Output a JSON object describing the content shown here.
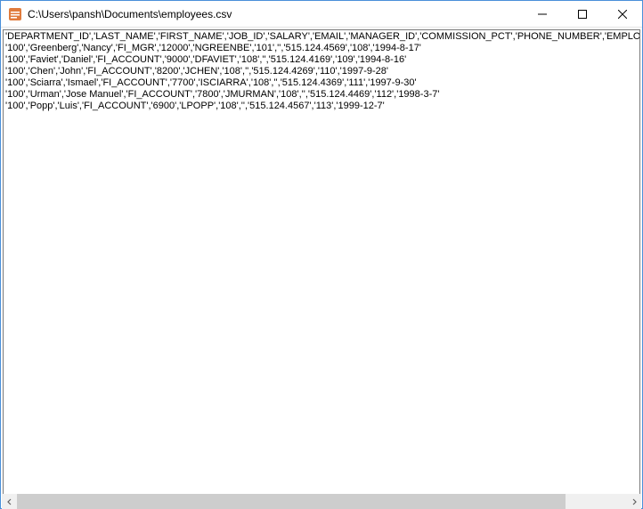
{
  "window": {
    "title": "C:\\Users\\pansh\\Documents\\employees.csv"
  },
  "content": {
    "lines": [
      "'DEPARTMENT_ID','LAST_NAME','FIRST_NAME','JOB_ID','SALARY','EMAIL','MANAGER_ID','COMMISSION_PCT','PHONE_NUMBER','EMPLOYEE_ID','H",
      "'100','Greenberg','Nancy','FI_MGR','12000','NGREENBE','101','','515.124.4569','108','1994-8-17'",
      "'100','Faviet','Daniel','FI_ACCOUNT','9000','DFAVIET','108','','515.124.4169','109','1994-8-16'",
      "'100','Chen','John','FI_ACCOUNT','8200','JCHEN','108','','515.124.4269','110','1997-9-28'",
      "'100','Sciarra','Ismael','FI_ACCOUNT','7700','ISCIARRA','108','','515.124.4369','111','1997-9-30'",
      "'100','Urman','Jose Manuel','FI_ACCOUNT','7800','JMURMAN','108','','515.124.4469','112','1998-3-7'",
      "'100','Popp','Luis','FI_ACCOUNT','6900','LPOPP','108','','515.124.4567','113','1999-12-7'"
    ]
  }
}
